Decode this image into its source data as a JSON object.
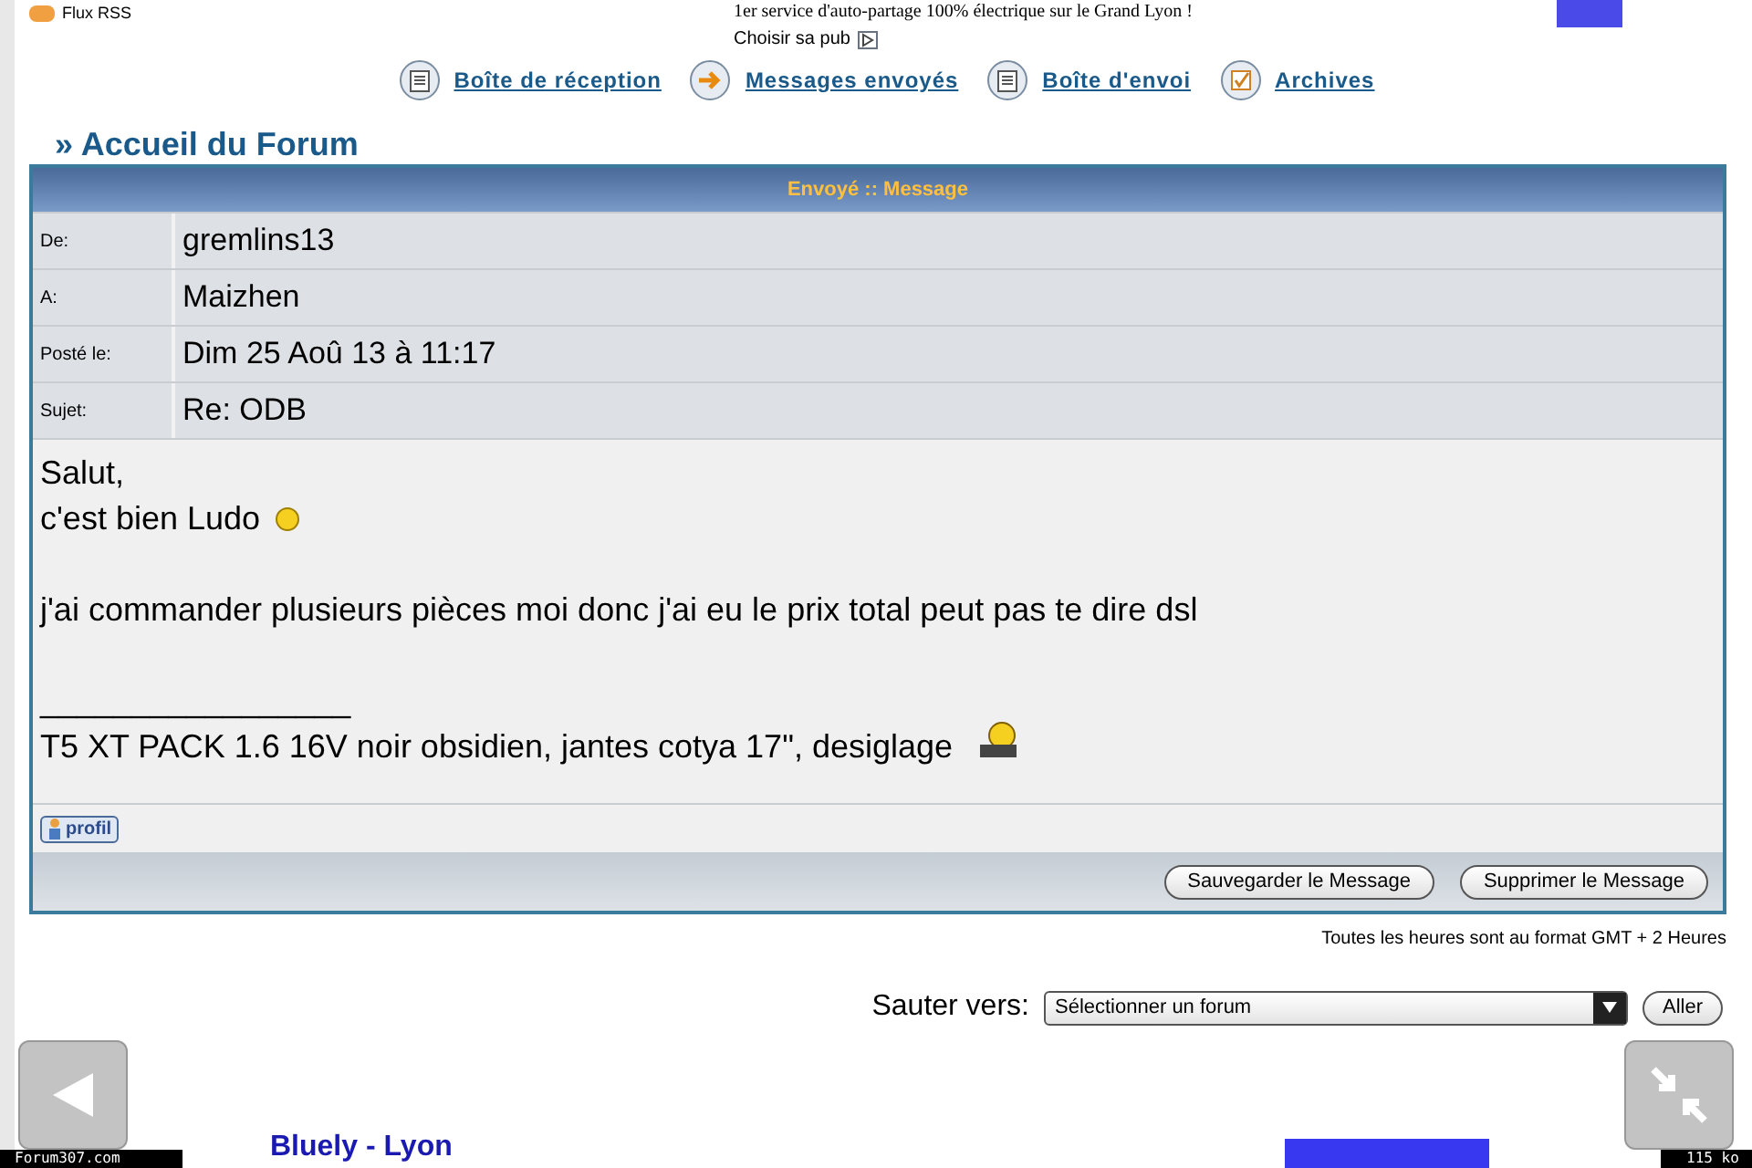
{
  "top_bar": {
    "rss_label": "Flux RSS",
    "ad_text": "1er service d'auto-partage 100% électrique sur le Grand Lyon !",
    "ad_choice": "Choisir sa pub"
  },
  "nav": [
    {
      "label": "Boîte de réception",
      "kind": "inbox"
    },
    {
      "label": "Messages envoyés",
      "kind": "arrow"
    },
    {
      "label": "Boîte d'envoi",
      "kind": "inbox"
    },
    {
      "label": "Archives",
      "kind": "check"
    }
  ],
  "breadcrumb": "» Accueil du Forum",
  "message": {
    "header": "Envoyé :: Message",
    "fields": [
      {
        "label": "De:",
        "value": "gremlins13"
      },
      {
        "label": "A:",
        "value": "Maizhen"
      },
      {
        "label": "Posté le:",
        "value": "Dim 25 Aoû 13 à 11:17"
      },
      {
        "label": "Sujet:",
        "value": "Re: ODB"
      }
    ],
    "body": [
      {
        "kind": "text",
        "text": "Salut,"
      },
      {
        "kind": "text_smiley",
        "text": "c'est bien Ludo"
      },
      {
        "kind": "blank"
      },
      {
        "kind": "text",
        "text": "j'ai commander plusieurs pièces moi donc j'ai eu le prix total peut pas te dire dsl"
      },
      {
        "kind": "blank"
      },
      {
        "kind": "text",
        "text": "_________________"
      },
      {
        "kind": "text_emote",
        "text": "T5 XT PACK 1.6 16V noir obsidien, jantes cotya 17\", desiglage"
      }
    ],
    "profile_button": "profil",
    "buttons": [
      "Sauvegarder le Message",
      "Supprimer le Message"
    ]
  },
  "timezone_note": "Toutes les heures sont au format GMT + 2 Heures",
  "jump": {
    "label": "Sauter vers:",
    "select": "Sélectionner un forum",
    "button": "Aller"
  },
  "bottom": {
    "site_label": "Forum307.com",
    "ad_title": "Bluely - Lyon",
    "size_label": "115 ko"
  }
}
